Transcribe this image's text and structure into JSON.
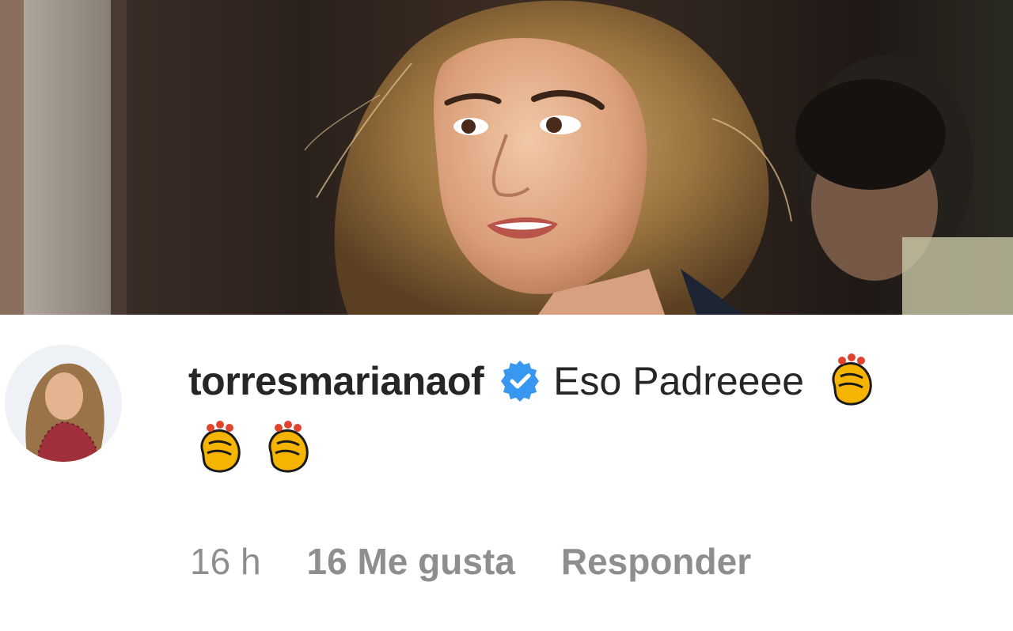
{
  "comment": {
    "username": "torresmarianaof",
    "verified": true,
    "text": "Eso Padreeee",
    "emoji": [
      "clapping-hands",
      "clapping-hands",
      "clapping-hands"
    ]
  },
  "meta": {
    "time": "16 h",
    "likes": "16 Me gusta",
    "reply": "Responder"
  },
  "colors": {
    "text": "#262626",
    "meta": "#8e8e8e",
    "verified": "#3897f0"
  }
}
